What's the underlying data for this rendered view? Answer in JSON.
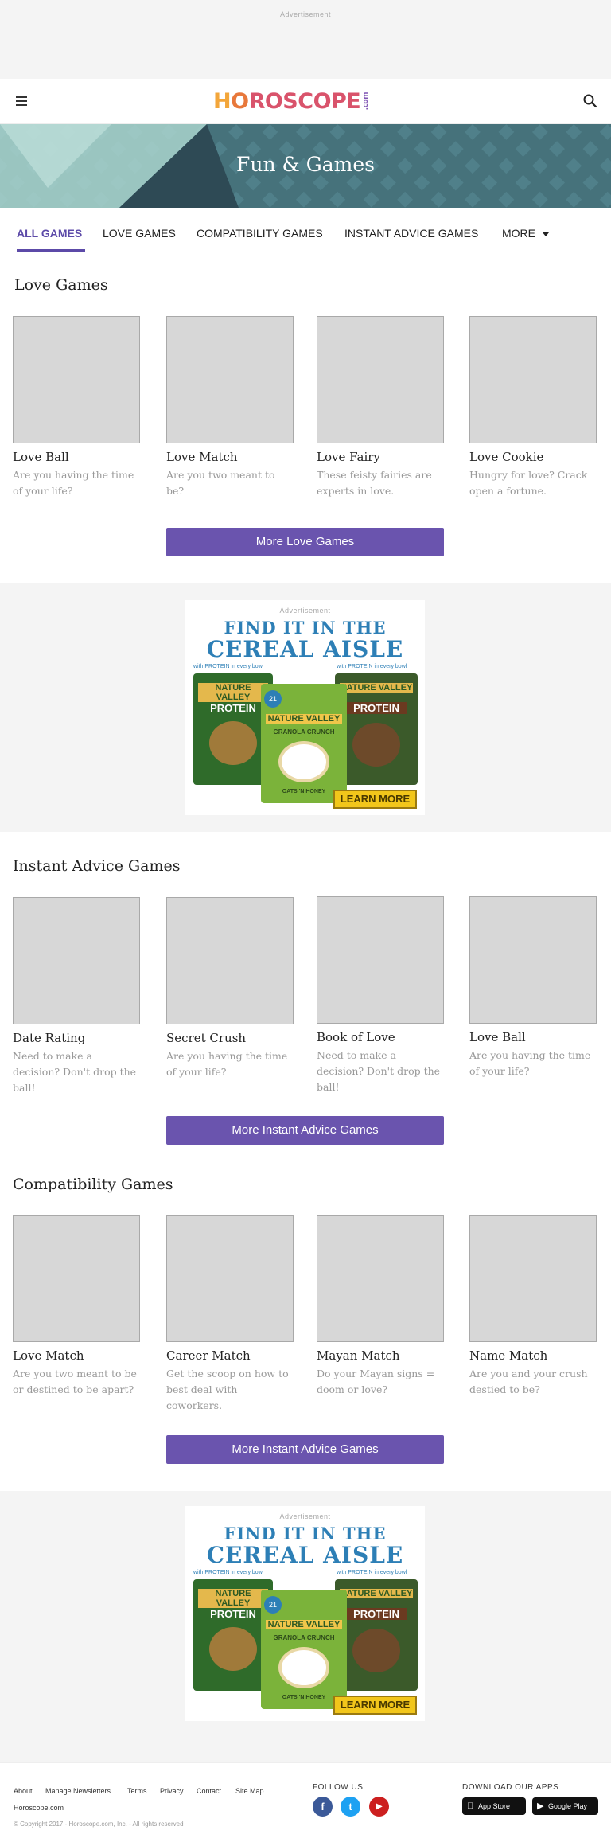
{
  "ads": {
    "label": "Advertisement"
  },
  "header": {
    "logo": {
      "l1": "H",
      "l2": "O",
      "l3": "ROSCOPE",
      "dotcom": ".com"
    }
  },
  "banner": {
    "title": "Fun & Games"
  },
  "tabs": [
    {
      "label": "ALL GAMES"
    },
    {
      "label": "LOVE GAMES"
    },
    {
      "label": "COMPATIBILITY GAMES"
    },
    {
      "label": "INSTANT ADVICE GAMES"
    },
    {
      "label": "MORE"
    }
  ],
  "sections": [
    {
      "title": "Love Games",
      "button": "More Love Games",
      "cards": [
        {
          "name": "Love Ball",
          "desc": "Are you having the time of your life?"
        },
        {
          "name": "Love Match",
          "desc": "Are you two meant to be?"
        },
        {
          "name": "Love Fairy",
          "desc": "These feisty fairies are experts in love."
        },
        {
          "name": "Love Cookie",
          "desc": "Hungry for love? Crack open a fortune."
        }
      ]
    },
    {
      "title": "Instant Advice Games",
      "button": "More Instant Advice Games",
      "cards": [
        {
          "name": "Date Rating",
          "desc": "Need to make a decision? Don't drop the ball!"
        },
        {
          "name": "Secret Crush",
          "desc": "Are you having the time of your life?"
        },
        {
          "name": "Book of Love",
          "desc": "Need to make a decision? Don't drop the ball!"
        },
        {
          "name": "Love Ball",
          "desc": "Are you having the time of your life?"
        }
      ]
    },
    {
      "title": "Compatibility  Games",
      "button": "More Instant Advice Games",
      "cards": [
        {
          "name": "Love Match",
          "desc": "Are you two meant to be or destined to be apart?"
        },
        {
          "name": "Career Match",
          "desc": "Get the scoop on how to best deal with coworkers."
        },
        {
          "name": "Mayan Match",
          "desc": "Do your Mayan signs = doom or love?"
        },
        {
          "name": "Name Match",
          "desc": "Are you and your crush destied to be?"
        }
      ]
    }
  ],
  "ad_creative": {
    "line1": "FIND IT IN THE",
    "line2": "CEREAL AISLE",
    "cta": "LEARN MORE",
    "brand": "NATURE VALLEY",
    "product_left": "PROTEIN",
    "product_center": "GRANOLA CRUNCH",
    "product_right": "PROTEIN",
    "tag_left": "with PROTEIN in every bowl",
    "tag_right": "with PROTEIN in every bowl",
    "badge": "21",
    "flavor": "OATS 'N HONEY"
  },
  "footer": {
    "links": [
      "About",
      "Manage Newsletters",
      "Terms",
      "Privacy",
      "Contact",
      "Site Map"
    ],
    "site": "Horoscope.com",
    "copyright": "© Copyright 2017 - Horoscope.com, Inc. - All rights reserved",
    "follow": "FOLLOW US",
    "social": {
      "facebook": "f",
      "twitter": "t",
      "youtube": "▶"
    },
    "download": "DOWNLOAD OUR APPS",
    "app_store": "App Store",
    "google_play": "Google Play"
  },
  "colors": {
    "accent": "#6a54ae",
    "tab_active": "#5c4aa8",
    "banner": "#3f6a73"
  },
  "icons": [
    "hamburger-menu-icon",
    "search-icon",
    "caret-down-icon",
    "facebook-icon",
    "twitter-icon",
    "youtube-icon",
    "apple-icon",
    "google-play-icon"
  ]
}
